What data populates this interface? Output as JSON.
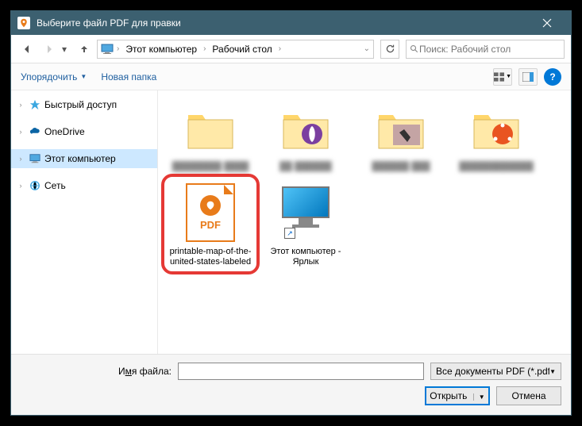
{
  "titlebar": {
    "title": "Выберите файл PDF для правки"
  },
  "breadcrumb": {
    "items": [
      "Этот компьютер",
      "Рабочий стол"
    ]
  },
  "search": {
    "placeholder": "Поиск: Рабочий стол"
  },
  "toolbar": {
    "organize": "Упорядочить",
    "newfolder": "Новая папка"
  },
  "tree": {
    "quick": "Быстрый доступ",
    "onedrive": "OneDrive",
    "thispc": "Этот компьютер",
    "network": "Сеть"
  },
  "content": {
    "pdf_label": "printable-map-of-the-united-states-labeled",
    "pc_label": "Этот компьютер - Ярлык",
    "pdf_badge": "PDF"
  },
  "footer": {
    "fname_label_pre": "И",
    "fname_label_u": "м",
    "fname_label_post": "я файла:",
    "filter": "Все документы PDF (*.pdf, *.pc",
    "open": "Открыть",
    "cancel": "Отмена"
  }
}
